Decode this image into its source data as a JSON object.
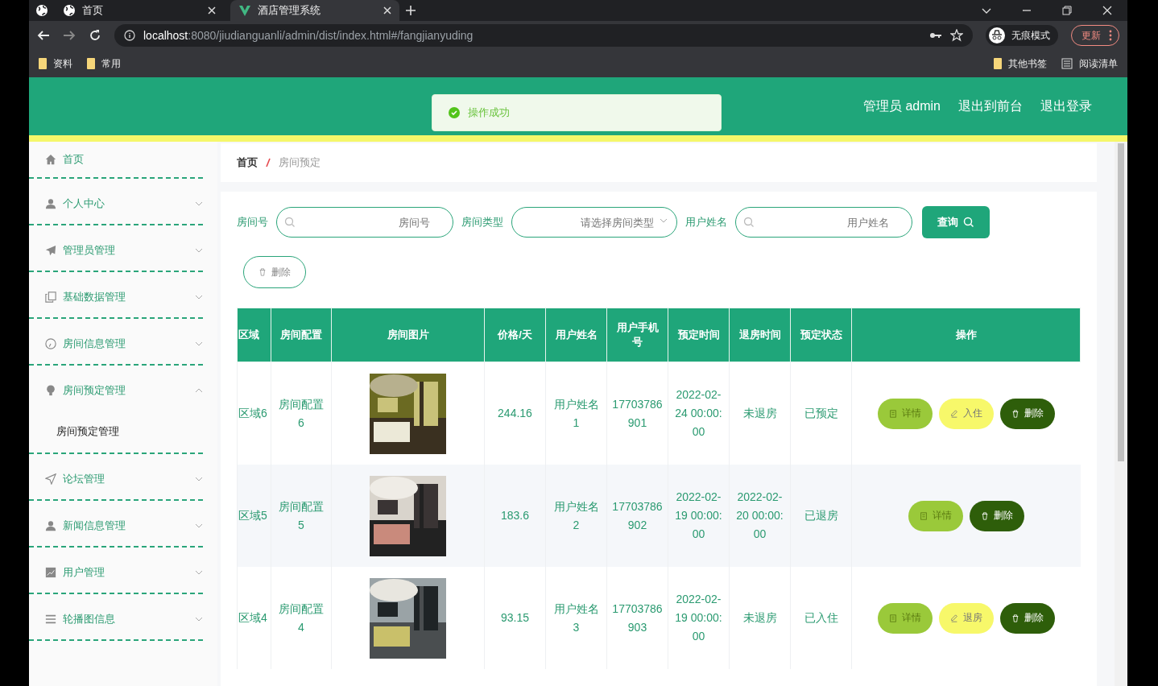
{
  "browser": {
    "tabs": [
      {
        "title": "首页",
        "selected": false
      },
      {
        "title": "酒店管理系统",
        "selected": true
      }
    ],
    "url": {
      "host": "localhost",
      "rest": ":8080/jiudianguanli/admin/dist/index.html#/fangjianyuding"
    },
    "bookmarks": [
      "资料",
      "常用"
    ],
    "bookmarks_right": [
      "其他书签",
      "阅读清单"
    ],
    "incognito": "无痕模式",
    "update": "更新"
  },
  "header": {
    "toast": "操作成功",
    "links": [
      "管理员 admin",
      "退出到前台",
      "退出登录"
    ]
  },
  "sidebar": {
    "items": [
      {
        "label": "首页"
      },
      {
        "label": "个人中心",
        "expanded": false
      },
      {
        "label": "管理员管理",
        "expanded": false
      },
      {
        "label": "基础数据管理",
        "expanded": false
      },
      {
        "label": "房间信息管理",
        "expanded": false
      },
      {
        "label": "房间预定管理",
        "expanded": true,
        "children": [
          {
            "label": "房间预定管理"
          }
        ]
      },
      {
        "label": "论坛管理",
        "expanded": false
      },
      {
        "label": "新闻信息管理",
        "expanded": false
      },
      {
        "label": "用户管理",
        "expanded": false
      },
      {
        "label": "轮播图信息",
        "expanded": false
      }
    ]
  },
  "breadcrumb": [
    "首页",
    "房间预定"
  ],
  "filters": [
    {
      "label": "房间号",
      "placeholder": "房间号",
      "kind": "text"
    },
    {
      "label": "房间类型",
      "placeholder": "请选择房间类型",
      "kind": "select"
    },
    {
      "label": "用户姓名",
      "placeholder": "用户姓名",
      "kind": "text"
    }
  ],
  "search_button": "查询",
  "delete_button": "删除",
  "table": {
    "columns": [
      "区域",
      "房间配置",
      "房间图片",
      "价格/天",
      "用户姓名",
      "用户手机号",
      "预定时间",
      "退房时间",
      "预定状态",
      "操作"
    ],
    "rows": [
      {
        "cells": [
          "区域6",
          "房间配置6",
          "",
          "244.16",
          "用户姓名1",
          "17703786901",
          "2022-02-24 00:00:00",
          "未退房",
          "已预定"
        ],
        "actions": [
          {
            "kind": "detail",
            "label": "详情"
          },
          {
            "kind": "edit",
            "label": "入住"
          },
          {
            "kind": "delete",
            "label": "删除"
          }
        ]
      },
      {
        "cells": [
          "区域5",
          "房间配置5",
          "",
          "183.6",
          "用户姓名2",
          "17703786902",
          "2022-02-19 00:00:00",
          "2022-02-20 00:00:00",
          "已退房"
        ],
        "actions": [
          {
            "kind": "detail",
            "label": "详情"
          },
          {
            "kind": "delete",
            "label": "删除"
          }
        ]
      },
      {
        "cells": [
          "区域4",
          "房间配置4",
          "",
          "93.15",
          "用户姓名3",
          "17703786903",
          "2022-02-19 00:00:00",
          "未退房",
          "已入住"
        ],
        "actions": [
          {
            "kind": "detail",
            "label": "详情"
          },
          {
            "kind": "edit",
            "label": "退房"
          },
          {
            "kind": "delete",
            "label": "删除"
          }
        ]
      }
    ]
  }
}
